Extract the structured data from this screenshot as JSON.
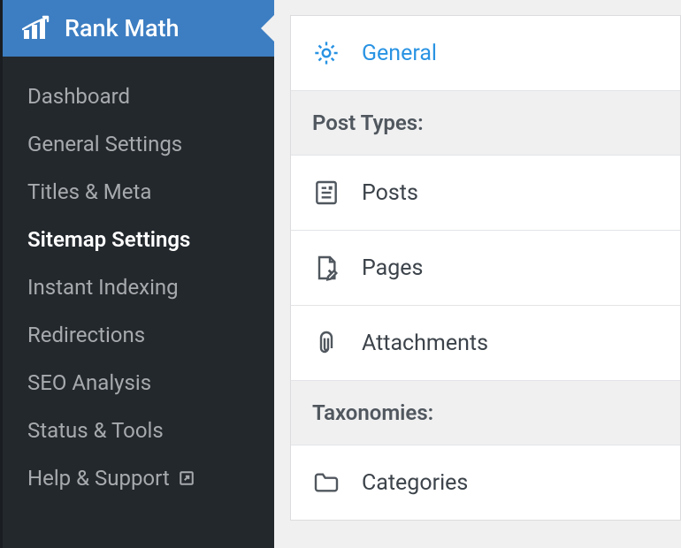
{
  "sidebar": {
    "title": "Rank Math",
    "items": [
      {
        "label": "Dashboard",
        "active": false
      },
      {
        "label": "General Settings",
        "active": false
      },
      {
        "label": "Titles & Meta",
        "active": false
      },
      {
        "label": "Sitemap Settings",
        "active": true
      },
      {
        "label": "Instant Indexing",
        "active": false
      },
      {
        "label": "Redirections",
        "active": false
      },
      {
        "label": "SEO Analysis",
        "active": false
      },
      {
        "label": "Status & Tools",
        "active": false
      },
      {
        "label": "Help & Support",
        "active": false,
        "external": true
      }
    ]
  },
  "main": {
    "general_label": "General",
    "post_types_header": "Post Types:",
    "posts_label": "Posts",
    "pages_label": "Pages",
    "attachments_label": "Attachments",
    "taxonomies_header": "Taxonomies:",
    "categories_label": "Categories"
  }
}
